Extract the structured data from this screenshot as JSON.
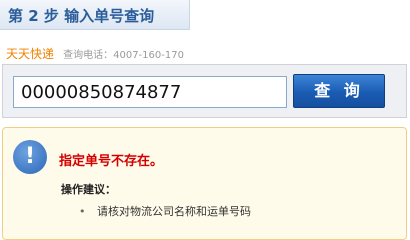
{
  "step": {
    "prefix": "第",
    "number": "2",
    "suffix": "步",
    "title": "输入单号查询"
  },
  "company": {
    "name": "天天快递",
    "phone_label": "查询电话：4007-160-170"
  },
  "search": {
    "tracking_number": "00000850874877",
    "button_label": "查 询"
  },
  "error": {
    "icon": "info-icon",
    "message": "指定单号不存在。",
    "advice_heading": "操作建议：",
    "advice_items": [
      "请核对物流公司名称和运单号码"
    ]
  },
  "colors": {
    "header_blue": "#2b5d9b",
    "company_orange": "#f08200",
    "error_red": "#d40000",
    "button_blue": "#1a5cb4",
    "notice_bg": "#fffbea"
  }
}
